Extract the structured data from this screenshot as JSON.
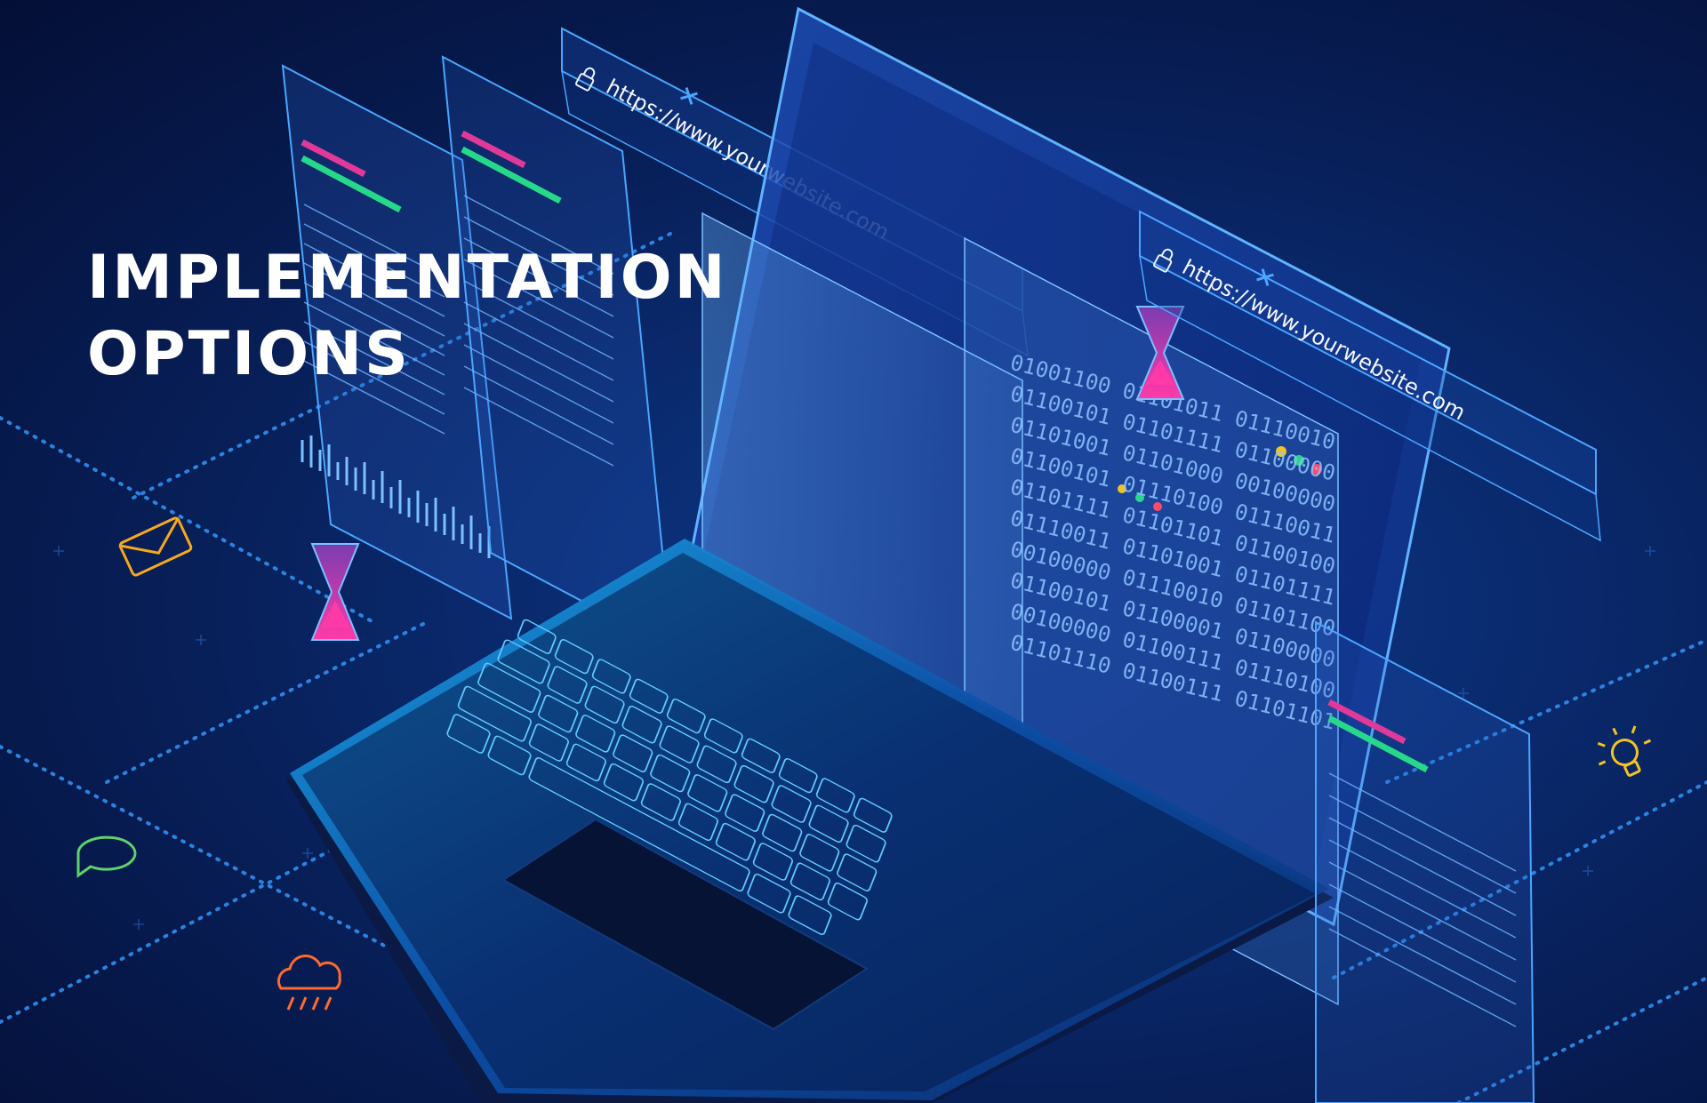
{
  "headline": {
    "line1": "IMPLEMENTATION",
    "line2": "OPTIONS"
  },
  "browser_bars": [
    {
      "url": "https://www.yourwebsite.com"
    },
    {
      "url": "https://www.yourwebsite.com"
    }
  ],
  "binary_lines": [
    "01001100 01101011 01110010",
    "01100101 01101111 01100000",
    "01101001 01101000 00100000",
    "01100101 01110100 01110011",
    "01101111 01101101 01100100",
    "01110011 01101001 01101111",
    "00100000 01110010 01101100",
    "01100101 01100001 01100000",
    "00100000 01100111 01110100",
    "01101110 01100111 01101101"
  ],
  "icons": [
    "envelope-icon",
    "chat-bubble-icon",
    "cloud-rain-icon",
    "lightbulb-icon",
    "hourglass-icon",
    "lock-icon",
    "close-icon"
  ],
  "colors": {
    "background": "#071c52",
    "glow_blue": "#3fa9ff",
    "magenta": "#e0399a",
    "green": "#26d98a",
    "orange": "#ff7a2e",
    "yellow": "#f3c324"
  }
}
